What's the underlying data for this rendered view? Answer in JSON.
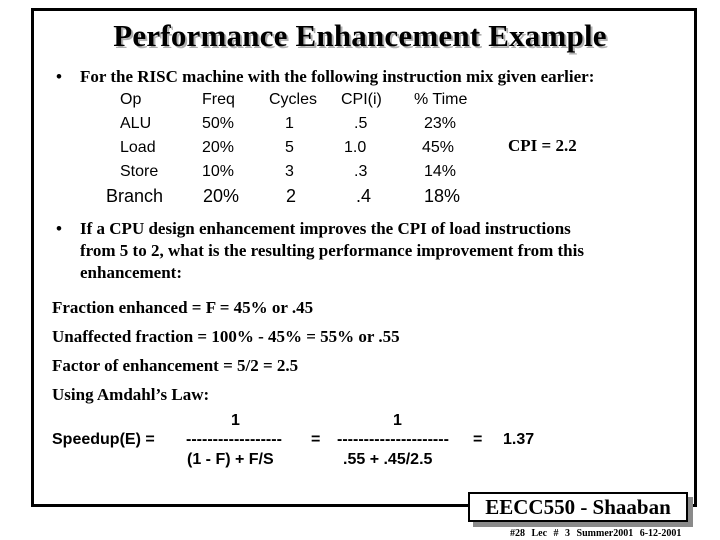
{
  "title": "Performance Enhancement Example",
  "bullets": {
    "intro": "For the RISC machine with the following instruction mix given earlier:",
    "question_lines": [
      "If a CPU design enhancement improves the CPI of load instructions",
      "from 5 to 2,  what is the resulting performance improvement from this",
      "enhancement:"
    ],
    "bullet_glyph": "•"
  },
  "table": {
    "headers": [
      "Op",
      "Freq",
      "Cycles",
      "CPI(i)",
      "% Time"
    ],
    "rows": [
      [
        "ALU",
        "50%",
        "1",
        ".5",
        "23%"
      ],
      [
        "Load",
        "20%",
        "5",
        "1.0",
        "45%"
      ],
      [
        "Store",
        "10%",
        "3",
        ".3",
        "14%"
      ],
      [
        "Branch",
        "20%",
        "2",
        ".4",
        "18%"
      ]
    ]
  },
  "cpi_total": "CPI =  2.2",
  "calc_lines": [
    "Fraction enhanced =  F =  45%  or  .45",
    "Unaffected fraction = 100% - 45% =  55%   or  .55",
    "Factor of enhancement =  5/2 =  2.5",
    "Using Amdahl’s Law:"
  ],
  "speedup": {
    "label": "Speedup(E)  =",
    "num1": "1",
    "dash1": "------------------",
    "den1": "(1 - F)  +  F/S",
    "eq2": "=",
    "num2": "1",
    "dash2": "---------------------",
    "den2": ".55  +  .45/2.5",
    "eq3": "=",
    "result": "1.37"
  },
  "footer": {
    "course": "EECC550 - Shaaban",
    "meta": "#28  Lec # 3   Summer2001   6-12-2001"
  }
}
